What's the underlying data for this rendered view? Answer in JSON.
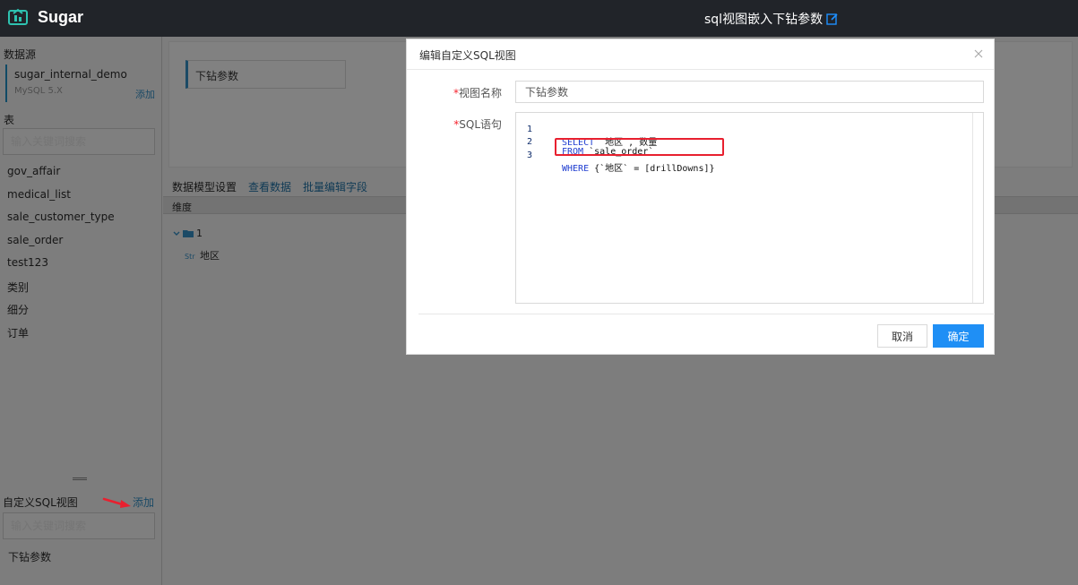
{
  "topbar": {
    "brand": "Sugar",
    "report_title": "sql视图嵌入下钻参数"
  },
  "sidebar": {
    "datasource_heading": "数据源",
    "datasource": {
      "name": "sugar_internal_demo",
      "type": "MySQL 5.X",
      "add_label": "添加"
    },
    "tables_heading": "表",
    "tables_search_placeholder": "输入关键词搜索",
    "tables": [
      "gov_affair",
      "medical_list",
      "sale_customer_type",
      "sale_order",
      "test123",
      "类别",
      "细分",
      "订单"
    ],
    "sql_views_heading": "自定义SQL视图",
    "sql_views_add_label": "添加",
    "sql_views_search_placeholder": "输入关键词搜索",
    "sql_views": [
      "下钻参数"
    ]
  },
  "main": {
    "view_tab": "下钻参数",
    "model_tabs": {
      "settings": "数据模型设置",
      "view_data": "查看数据",
      "batch_edit": "批量编辑字段"
    },
    "dimension_header": "维度",
    "tree": {
      "folder": "1",
      "field_type": "Str",
      "field": "地区"
    }
  },
  "modal": {
    "title": "编辑自定义SQL视图",
    "name_label": "视图名称",
    "name_value": "下钻参数",
    "sql_label": "SQL语句",
    "required_mark": "*",
    "code": [
      {
        "line": "1",
        "kw": "SELECT",
        "rest": " `地区`,`数量`"
      },
      {
        "line": "2",
        "kw": "FROM",
        "rest": " `sale_order`"
      },
      {
        "line": "3",
        "kw": "WHERE",
        "rest": " {`地区` = [drillDowns]}"
      }
    ],
    "cancel_label": "取消",
    "ok_label": "确定"
  },
  "colors": {
    "topbar": "#212429",
    "primary": "#1f8ff5",
    "highlight": "#e8202f"
  }
}
